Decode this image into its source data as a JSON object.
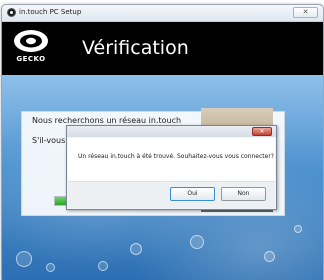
{
  "window": {
    "title": "in.touch PC Setup",
    "close_glyph": "✕"
  },
  "header": {
    "brand": "GECKO",
    "title": "Vérification"
  },
  "panel": {
    "line1": "Nous recherchons un réseau in.touch",
    "line2": "S'il-vous",
    "progress_fraction": 0.62
  },
  "dialog": {
    "close_glyph": "✕",
    "message": "Un réseau in.touch à été trouvé. Souhaitez-vous vous connecter?",
    "yes_label": "Oui",
    "no_label": "Non"
  },
  "colors": {
    "header_bg": "#000000",
    "progress": "#2fa52b",
    "background_water": "#4f93cf"
  },
  "icons": {
    "app": "gecko-logo-icon",
    "close": "close-icon"
  }
}
